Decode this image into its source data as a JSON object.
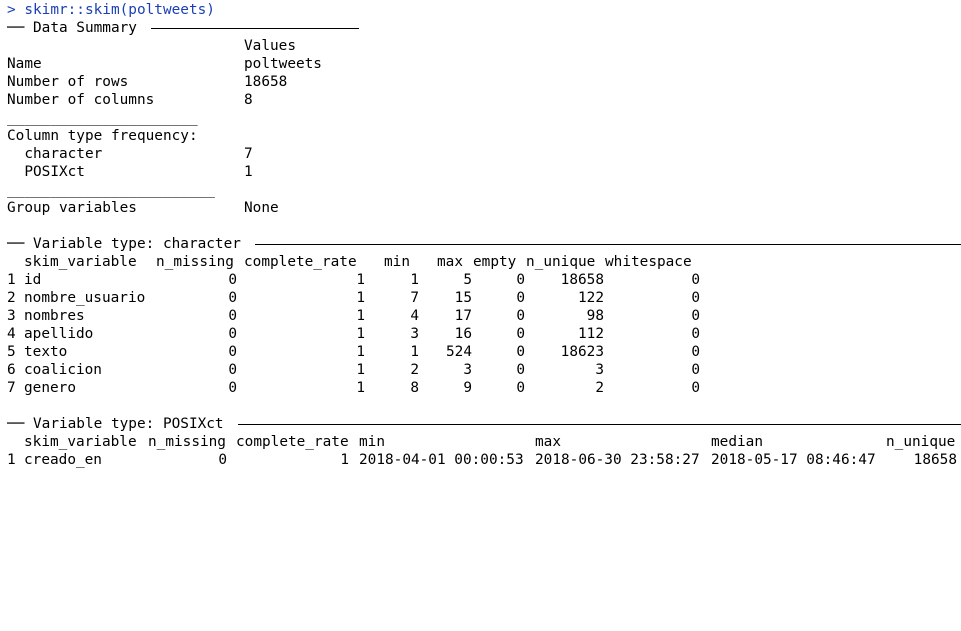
{
  "console": {
    "command": "> skimr::skim(poltweets)",
    "data_summary": {
      "header": "── Data Summary",
      "values_header": "Values",
      "rows": [
        {
          "label": "Name",
          "value": "poltweets"
        },
        {
          "label": "Number of rows",
          "value": "18658"
        },
        {
          "label": "Number of columns",
          "value": "8"
        }
      ],
      "separator1": "______________________",
      "type_freq_header": "Column type frequency:",
      "type_freq": [
        {
          "label": "  character",
          "value": "7"
        },
        {
          "label": "  POSIXct",
          "value": "1"
        }
      ],
      "separator2": "________________________",
      "group": {
        "label": "Group variables",
        "value": "None"
      }
    },
    "character_section": {
      "header": "── Variable type: character",
      "columns": [
        "skim_variable",
        "n_missing",
        "complete_rate",
        "min",
        "max",
        "empty",
        "n_unique",
        "whitespace"
      ],
      "rows": [
        [
          "1",
          "id",
          "0",
          "1",
          "1",
          "5",
          "0",
          "18658",
          "0"
        ],
        [
          "2",
          "nombre_usuario",
          "0",
          "1",
          "7",
          "15",
          "0",
          "122",
          "0"
        ],
        [
          "3",
          "nombres",
          "0",
          "1",
          "4",
          "17",
          "0",
          "98",
          "0"
        ],
        [
          "4",
          "apellido",
          "0",
          "1",
          "3",
          "16",
          "0",
          "112",
          "0"
        ],
        [
          "5",
          "texto",
          "0",
          "1",
          "1",
          "524",
          "0",
          "18623",
          "0"
        ],
        [
          "6",
          "coalicion",
          "0",
          "1",
          "2",
          "3",
          "0",
          "3",
          "0"
        ],
        [
          "7",
          "genero",
          "0",
          "1",
          "8",
          "9",
          "0",
          "2",
          "0"
        ]
      ]
    },
    "posixct_section": {
      "header": "── Variable type: POSIXct",
      "columns": [
        "skim_variable",
        "n_missing",
        "complete_rate",
        "min",
        "max",
        "median",
        "n_unique"
      ],
      "rows": [
        [
          "1",
          "creado_en",
          "0",
          "1",
          "2018-04-01 00:00:53",
          "2018-06-30 23:58:27",
          "2018-05-17 08:46:47",
          "18658"
        ]
      ]
    }
  }
}
